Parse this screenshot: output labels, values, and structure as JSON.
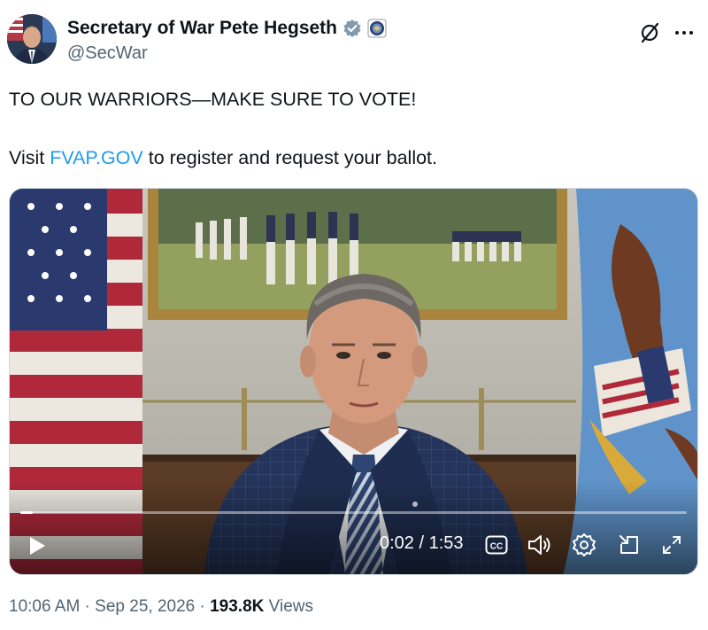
{
  "author": {
    "display_name": "Secretary of War Pete Hegseth",
    "handle": "@SecWar",
    "verified_badge_icon": "verified-badge-icon",
    "affiliation_icon": "affiliation-seal-icon"
  },
  "actions": {
    "grok_icon": "grok-icon",
    "more_icon": "more-options-icon"
  },
  "tweet": {
    "line1": "TO OUR WARRIORS—MAKE SURE TO VOTE!",
    "line2_prefix": "Visit ",
    "link_text": "FVAP.GOV",
    "line2_suffix": " to register and request your ballot."
  },
  "video": {
    "current_time": "0:02",
    "duration": "1:53",
    "time_display": "0:02 / 1:53",
    "progress_fraction": 0.018,
    "controls": [
      "play-icon",
      "closed-captions-icon",
      "volume-icon",
      "settings-gear-icon",
      "picture-in-picture-icon",
      "fullscreen-icon"
    ]
  },
  "meta": {
    "time": "10:06 AM",
    "separator": " · ",
    "date": "Sep 25, 2026",
    "views_count": "193.8K",
    "views_label": "Views"
  },
  "colors": {
    "link": "#1d9bf0",
    "text": "#0f1419",
    "secondary": "#536471",
    "verified": "#829aab"
  }
}
